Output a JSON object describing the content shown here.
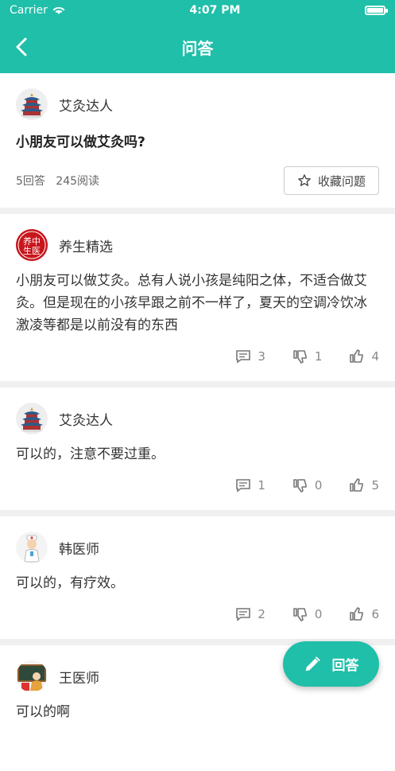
{
  "status": {
    "carrier": "Carrier",
    "time": "4:07 PM"
  },
  "nav": {
    "title": "问答"
  },
  "question": {
    "user": "艾灸达人",
    "title": "小朋友可以做艾灸吗?",
    "answers_count": "5回答",
    "reads_count": "245阅读",
    "collect_label": "收藏问题"
  },
  "answers": [
    {
      "user": "养生精选",
      "avatar_text": "养中生医",
      "text": "小朋友可以做艾灸。总有人说小孩是纯阳之体，不适合做艾灸。但是现在的小孩早跟之前不一样了，夏天的空调冷饮冰激凌等都是以前没有的东西",
      "comments": "3",
      "dislikes": "1",
      "likes": "4"
    },
    {
      "user": "艾灸达人",
      "text": "可以的，注意不要过重。",
      "comments": "1",
      "dislikes": "0",
      "likes": "5"
    },
    {
      "user": "韩医师",
      "text": "可以的，有疗效。",
      "comments": "2",
      "dislikes": "0",
      "likes": "6"
    },
    {
      "user": "王医师",
      "text": "可以的啊"
    }
  ],
  "fab": {
    "label": "回答"
  },
  "colors": {
    "accent": "#1fbfa9"
  }
}
